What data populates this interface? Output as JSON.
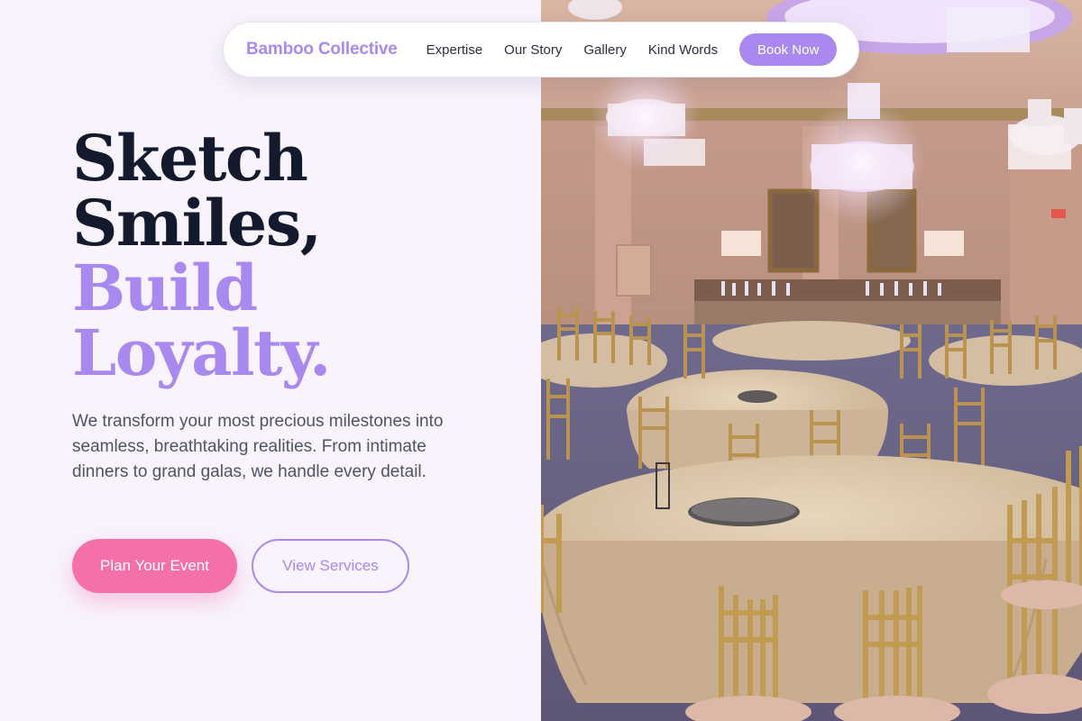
{
  "nav": {
    "brand": "Bamboo Collective",
    "links": [
      "Expertise",
      "Our Story",
      "Gallery",
      "Kind Words"
    ],
    "cta": "Book Now"
  },
  "hero": {
    "headline_dark": [
      "Sketch",
      "Smiles,"
    ],
    "headline_accent": [
      "Build",
      "Loyalty."
    ],
    "description": "We transform your most precious milestones into seamless, breathtaking realities. From intimate dinners to grand galas, we handle every detail.",
    "primary_cta": "Plan Your Event",
    "secondary_cta": "View Services"
  },
  "colors": {
    "accent": "#a989ef",
    "pink": "#f470ab",
    "dark": "#141a2e",
    "background": "#f8f3fd"
  },
  "image": {
    "subject": "ballroom-banquet-photo"
  }
}
